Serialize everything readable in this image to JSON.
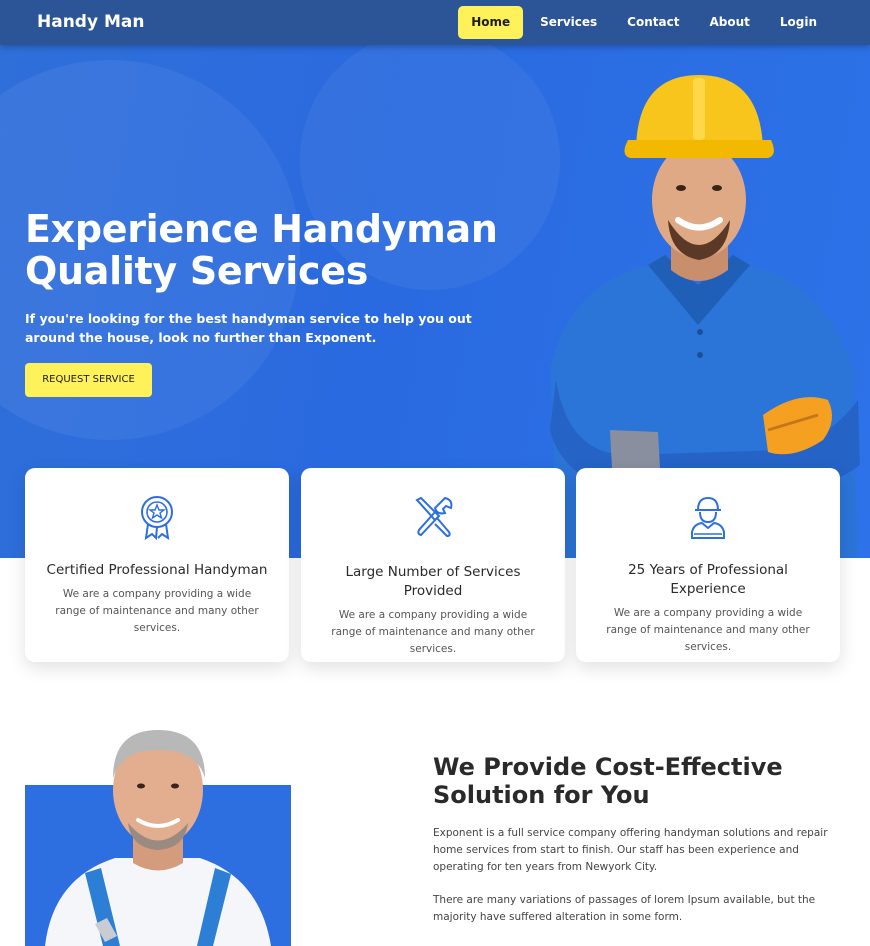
{
  "nav": {
    "brand": "Handy Man",
    "links": [
      "Home",
      "Services",
      "Contact",
      "About",
      "Login"
    ]
  },
  "hero": {
    "title": "Experience Handyman Quality Services",
    "subtitle": "If you're looking for the best handyman service to help you out around the house, look no further than Exponent.",
    "button": "REQUEST SERVICE"
  },
  "features": [
    {
      "icon": "award-badge-icon",
      "title": "Certified Professional Handyman",
      "text": "We are a company providing a wide range of maintenance and many other services."
    },
    {
      "icon": "tools-icon",
      "title": "Large Number of Services Provided",
      "text": "We are a company providing a wide range of maintenance and many other services."
    },
    {
      "icon": "worker-icon",
      "title": "25 Years of Professional Experience",
      "text": "We are a company providing a wide range of maintenance and many other services."
    }
  ],
  "about": {
    "title": "We Provide Cost-Effective Solution for You",
    "p1": "Exponent is a full service company offering handyman solutions and repair home services from start to finish. Our staff has been experience and operating for ten years from Newyork City.",
    "p2": "There are many variations of passages of lorem Ipsum available, but the majority have suffered alteration in some form."
  },
  "colors": {
    "primary": "#2d6fe0",
    "accent": "#fef15a",
    "nav": "#2c5597"
  }
}
